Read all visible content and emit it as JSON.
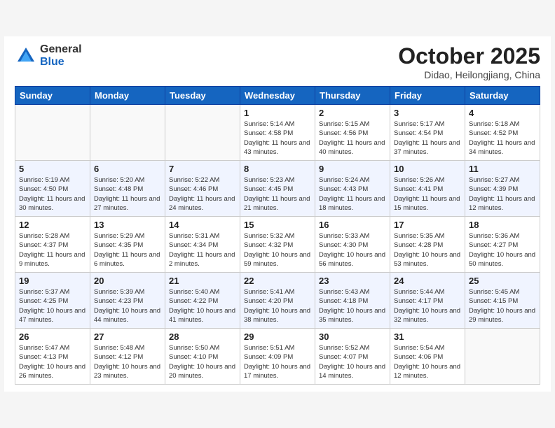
{
  "logo": {
    "general": "General",
    "blue": "Blue"
  },
  "title": "October 2025",
  "location": "Didao, Heilongjiang, China",
  "weekdays": [
    "Sunday",
    "Monday",
    "Tuesday",
    "Wednesday",
    "Thursday",
    "Friday",
    "Saturday"
  ],
  "weeks": [
    [
      {
        "day": "",
        "info": ""
      },
      {
        "day": "",
        "info": ""
      },
      {
        "day": "",
        "info": ""
      },
      {
        "day": "1",
        "info": "Sunrise: 5:14 AM\nSunset: 4:58 PM\nDaylight: 11 hours\nand 43 minutes."
      },
      {
        "day": "2",
        "info": "Sunrise: 5:15 AM\nSunset: 4:56 PM\nDaylight: 11 hours\nand 40 minutes."
      },
      {
        "day": "3",
        "info": "Sunrise: 5:17 AM\nSunset: 4:54 PM\nDaylight: 11 hours\nand 37 minutes."
      },
      {
        "day": "4",
        "info": "Sunrise: 5:18 AM\nSunset: 4:52 PM\nDaylight: 11 hours\nand 34 minutes."
      }
    ],
    [
      {
        "day": "5",
        "info": "Sunrise: 5:19 AM\nSunset: 4:50 PM\nDaylight: 11 hours\nand 30 minutes."
      },
      {
        "day": "6",
        "info": "Sunrise: 5:20 AM\nSunset: 4:48 PM\nDaylight: 11 hours\nand 27 minutes."
      },
      {
        "day": "7",
        "info": "Sunrise: 5:22 AM\nSunset: 4:46 PM\nDaylight: 11 hours\nand 24 minutes."
      },
      {
        "day": "8",
        "info": "Sunrise: 5:23 AM\nSunset: 4:45 PM\nDaylight: 11 hours\nand 21 minutes."
      },
      {
        "day": "9",
        "info": "Sunrise: 5:24 AM\nSunset: 4:43 PM\nDaylight: 11 hours\nand 18 minutes."
      },
      {
        "day": "10",
        "info": "Sunrise: 5:26 AM\nSunset: 4:41 PM\nDaylight: 11 hours\nand 15 minutes."
      },
      {
        "day": "11",
        "info": "Sunrise: 5:27 AM\nSunset: 4:39 PM\nDaylight: 11 hours\nand 12 minutes."
      }
    ],
    [
      {
        "day": "12",
        "info": "Sunrise: 5:28 AM\nSunset: 4:37 PM\nDaylight: 11 hours\nand 9 minutes."
      },
      {
        "day": "13",
        "info": "Sunrise: 5:29 AM\nSunset: 4:35 PM\nDaylight: 11 hours\nand 6 minutes."
      },
      {
        "day": "14",
        "info": "Sunrise: 5:31 AM\nSunset: 4:34 PM\nDaylight: 11 hours\nand 2 minutes."
      },
      {
        "day": "15",
        "info": "Sunrise: 5:32 AM\nSunset: 4:32 PM\nDaylight: 10 hours\nand 59 minutes."
      },
      {
        "day": "16",
        "info": "Sunrise: 5:33 AM\nSunset: 4:30 PM\nDaylight: 10 hours\nand 56 minutes."
      },
      {
        "day": "17",
        "info": "Sunrise: 5:35 AM\nSunset: 4:28 PM\nDaylight: 10 hours\nand 53 minutes."
      },
      {
        "day": "18",
        "info": "Sunrise: 5:36 AM\nSunset: 4:27 PM\nDaylight: 10 hours\nand 50 minutes."
      }
    ],
    [
      {
        "day": "19",
        "info": "Sunrise: 5:37 AM\nSunset: 4:25 PM\nDaylight: 10 hours\nand 47 minutes."
      },
      {
        "day": "20",
        "info": "Sunrise: 5:39 AM\nSunset: 4:23 PM\nDaylight: 10 hours\nand 44 minutes."
      },
      {
        "day": "21",
        "info": "Sunrise: 5:40 AM\nSunset: 4:22 PM\nDaylight: 10 hours\nand 41 minutes."
      },
      {
        "day": "22",
        "info": "Sunrise: 5:41 AM\nSunset: 4:20 PM\nDaylight: 10 hours\nand 38 minutes."
      },
      {
        "day": "23",
        "info": "Sunrise: 5:43 AM\nSunset: 4:18 PM\nDaylight: 10 hours\nand 35 minutes."
      },
      {
        "day": "24",
        "info": "Sunrise: 5:44 AM\nSunset: 4:17 PM\nDaylight: 10 hours\nand 32 minutes."
      },
      {
        "day": "25",
        "info": "Sunrise: 5:45 AM\nSunset: 4:15 PM\nDaylight: 10 hours\nand 29 minutes."
      }
    ],
    [
      {
        "day": "26",
        "info": "Sunrise: 5:47 AM\nSunset: 4:13 PM\nDaylight: 10 hours\nand 26 minutes."
      },
      {
        "day": "27",
        "info": "Sunrise: 5:48 AM\nSunset: 4:12 PM\nDaylight: 10 hours\nand 23 minutes."
      },
      {
        "day": "28",
        "info": "Sunrise: 5:50 AM\nSunset: 4:10 PM\nDaylight: 10 hours\nand 20 minutes."
      },
      {
        "day": "29",
        "info": "Sunrise: 5:51 AM\nSunset: 4:09 PM\nDaylight: 10 hours\nand 17 minutes."
      },
      {
        "day": "30",
        "info": "Sunrise: 5:52 AM\nSunset: 4:07 PM\nDaylight: 10 hours\nand 14 minutes."
      },
      {
        "day": "31",
        "info": "Sunrise: 5:54 AM\nSunset: 4:06 PM\nDaylight: 10 hours\nand 12 minutes."
      },
      {
        "day": "",
        "info": ""
      }
    ]
  ]
}
